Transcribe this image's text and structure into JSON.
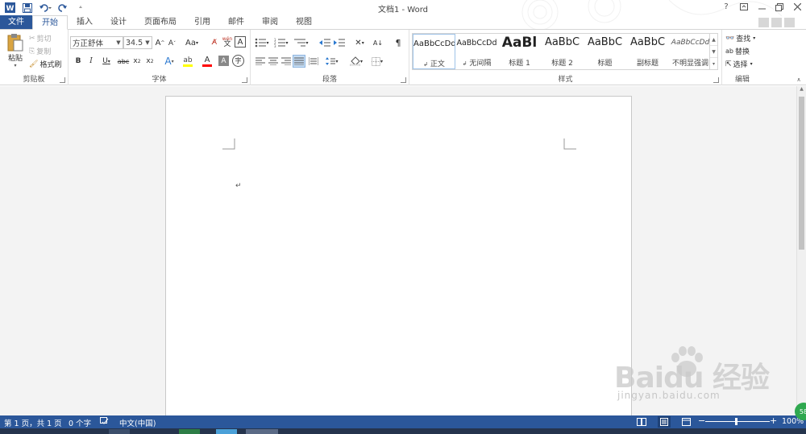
{
  "window": {
    "title": "文档1 - Word",
    "controls": [
      "?",
      "restore",
      "minimize",
      "maximize",
      "close"
    ]
  },
  "tabs": [
    {
      "label": "文件",
      "type": "file"
    },
    {
      "label": "开始",
      "active": true
    },
    {
      "label": "插入"
    },
    {
      "label": "设计"
    },
    {
      "label": "页面布局"
    },
    {
      "label": "引用"
    },
    {
      "label": "邮件"
    },
    {
      "label": "审阅"
    },
    {
      "label": "视图"
    }
  ],
  "ribbon": {
    "clipboard": {
      "label": "剪贴板",
      "paste": "粘贴",
      "cut": "剪切",
      "copy": "复制",
      "format_painter": "格式刷"
    },
    "font": {
      "label": "字体",
      "font_name": "方正舒体",
      "font_size": "34.5",
      "pinyin": "wén\n文",
      "char_border": "A"
    },
    "paragraph": {
      "label": "段落"
    },
    "styles": {
      "label": "样式",
      "items": [
        {
          "sample": "AaBbCcDd",
          "name": "正文",
          "selected": true,
          "mark": "↲"
        },
        {
          "sample": "AaBbCcDd",
          "name": "无间隔",
          "mark": "↲"
        },
        {
          "sample": "AaBl",
          "name": "标题 1"
        },
        {
          "sample": "AaBbC",
          "name": "标题 2"
        },
        {
          "sample": "AaBbC",
          "name": "标题"
        },
        {
          "sample": "AaBbC",
          "name": "副标题"
        },
        {
          "sample": "AaBbCcDd",
          "name": "不明显强调"
        }
      ]
    },
    "editing": {
      "label": "编辑",
      "find": "查找",
      "replace": "替换",
      "select": "选择"
    }
  },
  "document": {
    "paragraph_mark": "↵"
  },
  "statusbar": {
    "page": "第 1 页，共 1 页",
    "words": "0 个字",
    "language": "中文(中国)",
    "zoom": "100%"
  },
  "watermark": {
    "logo": "Baidu 经验",
    "url": "jingyan.baidu.com"
  },
  "badge": "58",
  "colors": {
    "accent": "#2b579a",
    "highlight": "#ffff00",
    "font_color": "#ff0000"
  }
}
